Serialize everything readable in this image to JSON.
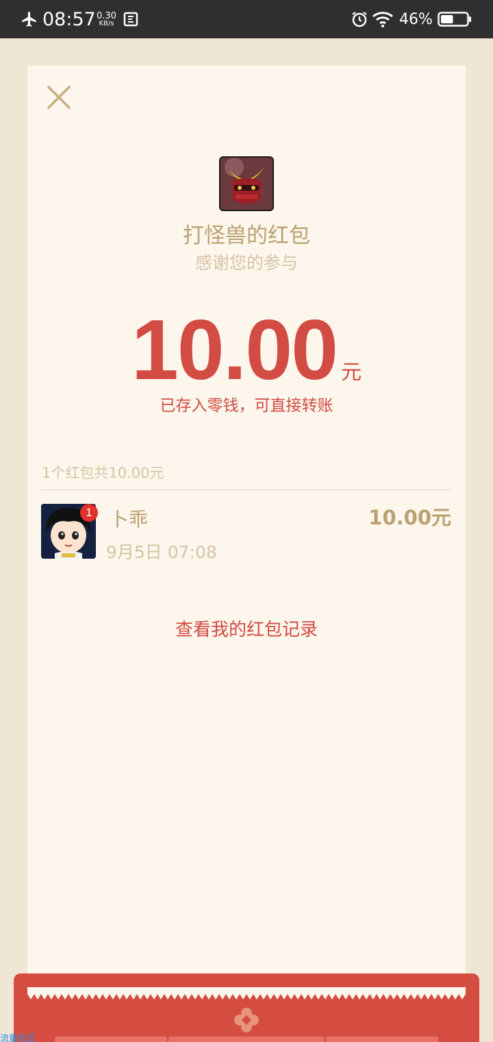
{
  "status_bar": {
    "time": "08:57",
    "net_speed_value": "0.30",
    "net_speed_unit": "KB/s",
    "battery_percent": "46%",
    "icons": [
      "airplane-icon",
      "screenshot-icon",
      "alarm-icon",
      "wifi-icon",
      "battery-icon"
    ],
    "battery_level": 0.46
  },
  "envelope": {
    "title": "打怪兽的红包",
    "subtitle": "感谢您的参与",
    "amount": "10.00",
    "unit": "元",
    "stored_note": "已存入零钱，可直接转账"
  },
  "summary": "1个红包共10.00元",
  "receivers": [
    {
      "name": "卜乖",
      "time": "9月5日  07:08",
      "amount": "10.00元",
      "badge": "1"
    }
  ],
  "records_link": "查看我的红包记录",
  "watermark": "流量社区",
  "colors": {
    "accent_red": "#d24c43",
    "gold_text": "#bba172",
    "muted_text": "#d6c4a4",
    "panel_bg": "#fcf6ec",
    "page_bg": "#efe6d6",
    "footer_red": "#d44d40"
  }
}
